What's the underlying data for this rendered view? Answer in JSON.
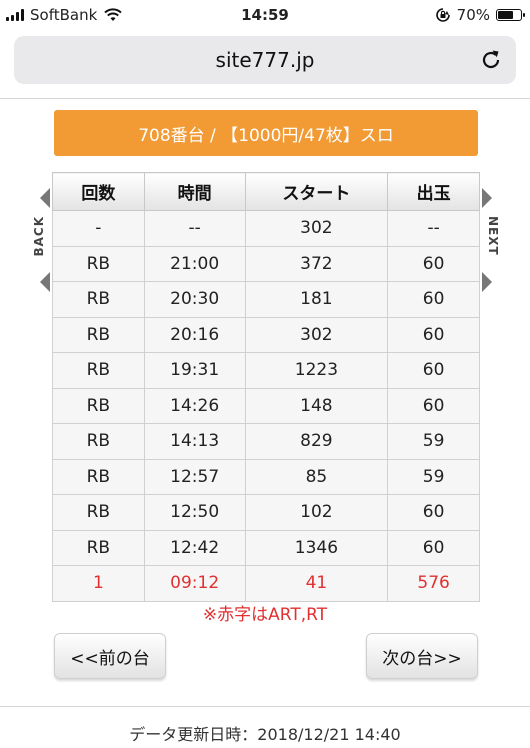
{
  "status_bar": {
    "carrier": "SoftBank",
    "time": "14:59",
    "battery": "70%",
    "battery_level": 0.7
  },
  "browser": {
    "url": "site777.jp"
  },
  "header": {
    "title": "708番台 / 【1000円/47枚】スロ"
  },
  "side_nav": {
    "back_label": "BACK",
    "next_label": "NEXT"
  },
  "table": {
    "columns": [
      "回数",
      "時間",
      "スタート",
      "出玉"
    ],
    "rows": [
      [
        "-",
        "--",
        "302",
        "--"
      ],
      [
        "RB",
        "21:00",
        "372",
        "60"
      ],
      [
        "RB",
        "20:30",
        "181",
        "60"
      ],
      [
        "RB",
        "20:16",
        "302",
        "60"
      ],
      [
        "RB",
        "19:31",
        "1223",
        "60"
      ],
      [
        "RB",
        "14:26",
        "148",
        "60"
      ],
      [
        "RB",
        "14:13",
        "829",
        "59"
      ],
      [
        "RB",
        "12:57",
        "85",
        "59"
      ],
      [
        "RB",
        "12:50",
        "102",
        "60"
      ],
      [
        "RB",
        "12:42",
        "1346",
        "60"
      ],
      [
        "1",
        "09:12",
        "41",
        "576"
      ]
    ],
    "highlight_color": "#e03030"
  },
  "note": "※赤字はART,RT",
  "buttons": {
    "prev_label": "<<前の台",
    "next_label": "次の台>>"
  },
  "footer": {
    "updated": "データ更新日時：2018/12/21 14:40"
  },
  "colors": {
    "accent": "#f29a33",
    "highlight": "#e03030"
  }
}
